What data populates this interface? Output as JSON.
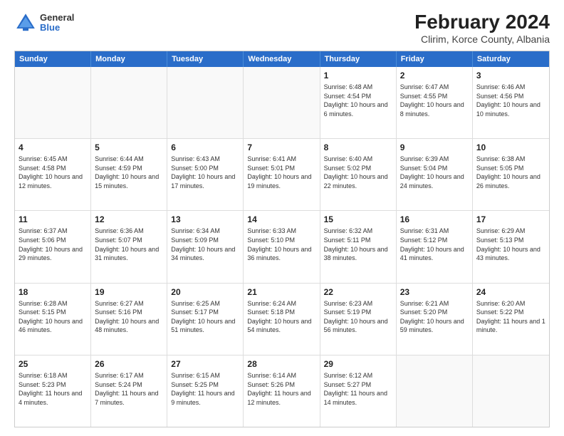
{
  "logo": {
    "general": "General",
    "blue": "Blue"
  },
  "title": "February 2024",
  "subtitle": "Clirim, Korce County, Albania",
  "header_days": [
    "Sunday",
    "Monday",
    "Tuesday",
    "Wednesday",
    "Thursday",
    "Friday",
    "Saturday"
  ],
  "weeks": [
    [
      {
        "day": "",
        "empty": true
      },
      {
        "day": "",
        "empty": true
      },
      {
        "day": "",
        "empty": true
      },
      {
        "day": "",
        "empty": true
      },
      {
        "day": "1",
        "sunrise": "6:48 AM",
        "sunset": "4:54 PM",
        "daylight": "Daylight: 10 hours and 6 minutes."
      },
      {
        "day": "2",
        "sunrise": "6:47 AM",
        "sunset": "4:55 PM",
        "daylight": "Daylight: 10 hours and 8 minutes."
      },
      {
        "day": "3",
        "sunrise": "6:46 AM",
        "sunset": "4:56 PM",
        "daylight": "Daylight: 10 hours and 10 minutes."
      }
    ],
    [
      {
        "day": "4",
        "sunrise": "6:45 AM",
        "sunset": "4:58 PM",
        "daylight": "Daylight: 10 hours and 12 minutes."
      },
      {
        "day": "5",
        "sunrise": "6:44 AM",
        "sunset": "4:59 PM",
        "daylight": "Daylight: 10 hours and 15 minutes."
      },
      {
        "day": "6",
        "sunrise": "6:43 AM",
        "sunset": "5:00 PM",
        "daylight": "Daylight: 10 hours and 17 minutes."
      },
      {
        "day": "7",
        "sunrise": "6:41 AM",
        "sunset": "5:01 PM",
        "daylight": "Daylight: 10 hours and 19 minutes."
      },
      {
        "day": "8",
        "sunrise": "6:40 AM",
        "sunset": "5:02 PM",
        "daylight": "Daylight: 10 hours and 22 minutes."
      },
      {
        "day": "9",
        "sunrise": "6:39 AM",
        "sunset": "5:04 PM",
        "daylight": "Daylight: 10 hours and 24 minutes."
      },
      {
        "day": "10",
        "sunrise": "6:38 AM",
        "sunset": "5:05 PM",
        "daylight": "Daylight: 10 hours and 26 minutes."
      }
    ],
    [
      {
        "day": "11",
        "sunrise": "6:37 AM",
        "sunset": "5:06 PM",
        "daylight": "Daylight: 10 hours and 29 minutes."
      },
      {
        "day": "12",
        "sunrise": "6:36 AM",
        "sunset": "5:07 PM",
        "daylight": "Daylight: 10 hours and 31 minutes."
      },
      {
        "day": "13",
        "sunrise": "6:34 AM",
        "sunset": "5:09 PM",
        "daylight": "Daylight: 10 hours and 34 minutes."
      },
      {
        "day": "14",
        "sunrise": "6:33 AM",
        "sunset": "5:10 PM",
        "daylight": "Daylight: 10 hours and 36 minutes."
      },
      {
        "day": "15",
        "sunrise": "6:32 AM",
        "sunset": "5:11 PM",
        "daylight": "Daylight: 10 hours and 38 minutes."
      },
      {
        "day": "16",
        "sunrise": "6:31 AM",
        "sunset": "5:12 PM",
        "daylight": "Daylight: 10 hours and 41 minutes."
      },
      {
        "day": "17",
        "sunrise": "6:29 AM",
        "sunset": "5:13 PM",
        "daylight": "Daylight: 10 hours and 43 minutes."
      }
    ],
    [
      {
        "day": "18",
        "sunrise": "6:28 AM",
        "sunset": "5:15 PM",
        "daylight": "Daylight: 10 hours and 46 minutes."
      },
      {
        "day": "19",
        "sunrise": "6:27 AM",
        "sunset": "5:16 PM",
        "daylight": "Daylight: 10 hours and 48 minutes."
      },
      {
        "day": "20",
        "sunrise": "6:25 AM",
        "sunset": "5:17 PM",
        "daylight": "Daylight: 10 hours and 51 minutes."
      },
      {
        "day": "21",
        "sunrise": "6:24 AM",
        "sunset": "5:18 PM",
        "daylight": "Daylight: 10 hours and 54 minutes."
      },
      {
        "day": "22",
        "sunrise": "6:23 AM",
        "sunset": "5:19 PM",
        "daylight": "Daylight: 10 hours and 56 minutes."
      },
      {
        "day": "23",
        "sunrise": "6:21 AM",
        "sunset": "5:20 PM",
        "daylight": "Daylight: 10 hours and 59 minutes."
      },
      {
        "day": "24",
        "sunrise": "6:20 AM",
        "sunset": "5:22 PM",
        "daylight": "Daylight: 11 hours and 1 minute."
      }
    ],
    [
      {
        "day": "25",
        "sunrise": "6:18 AM",
        "sunset": "5:23 PM",
        "daylight": "Daylight: 11 hours and 4 minutes."
      },
      {
        "day": "26",
        "sunrise": "6:17 AM",
        "sunset": "5:24 PM",
        "daylight": "Daylight: 11 hours and 7 minutes."
      },
      {
        "day": "27",
        "sunrise": "6:15 AM",
        "sunset": "5:25 PM",
        "daylight": "Daylight: 11 hours and 9 minutes."
      },
      {
        "day": "28",
        "sunrise": "6:14 AM",
        "sunset": "5:26 PM",
        "daylight": "Daylight: 11 hours and 12 minutes."
      },
      {
        "day": "29",
        "sunrise": "6:12 AM",
        "sunset": "5:27 PM",
        "daylight": "Daylight: 11 hours and 14 minutes."
      },
      {
        "day": "",
        "empty": true
      },
      {
        "day": "",
        "empty": true
      }
    ]
  ]
}
